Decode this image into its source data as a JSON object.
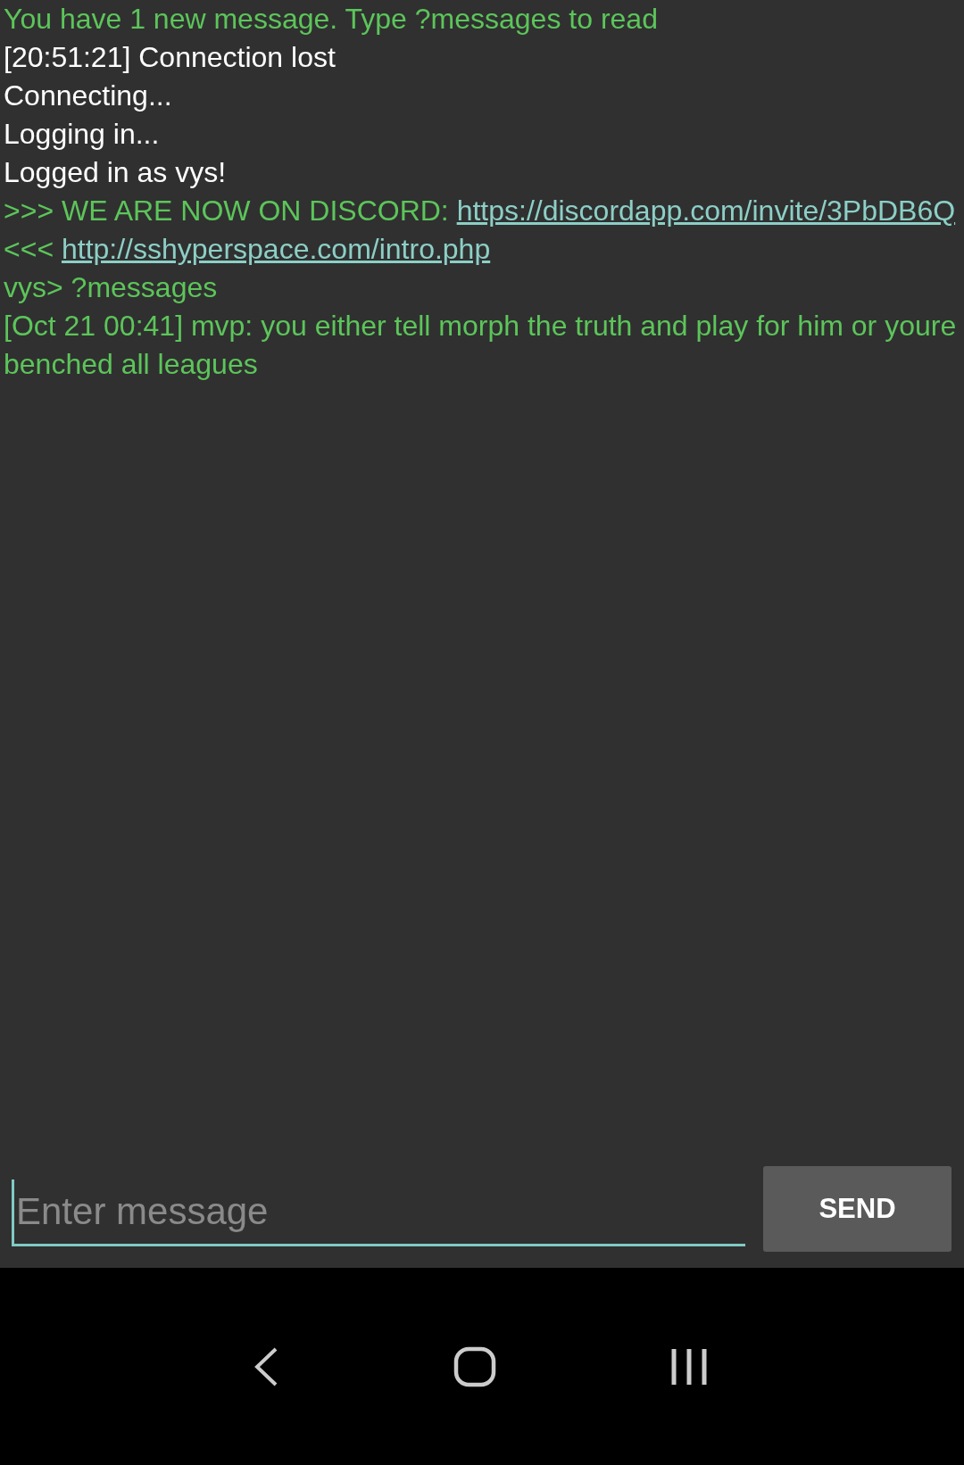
{
  "log": [
    {
      "kind": "notice",
      "parts": [
        {
          "text": "You have 1 new message. Type ?messages to read"
        }
      ]
    },
    {
      "kind": "status",
      "parts": [
        {
          "text": "[20:51:21] Connection lost"
        }
      ]
    },
    {
      "kind": "status",
      "parts": [
        {
          "text": "Connecting..."
        }
      ]
    },
    {
      "kind": "status",
      "parts": [
        {
          "text": "Logging in..."
        }
      ]
    },
    {
      "kind": "status",
      "parts": [
        {
          "text": "Logged in as vys!"
        }
      ]
    },
    {
      "kind": "notice",
      "parts": [
        {
          "text": ">>> WE ARE NOW ON DISCORD: "
        },
        {
          "link": "https://discordapp.com/invite/3PbDB6Q"
        },
        {
          "text": " <<< "
        },
        {
          "link": "http://sshyperspace.com/intro.php"
        }
      ]
    },
    {
      "kind": "notice",
      "parts": [
        {
          "text": "vys> ?messages"
        }
      ]
    },
    {
      "kind": "notice",
      "parts": [
        {
          "text": "[Oct 21 00:41] mvp: you either tell morph the truth and play for him or youre benched all leagues"
        }
      ]
    }
  ],
  "composer": {
    "placeholder": "Enter message",
    "button": "SEND"
  }
}
